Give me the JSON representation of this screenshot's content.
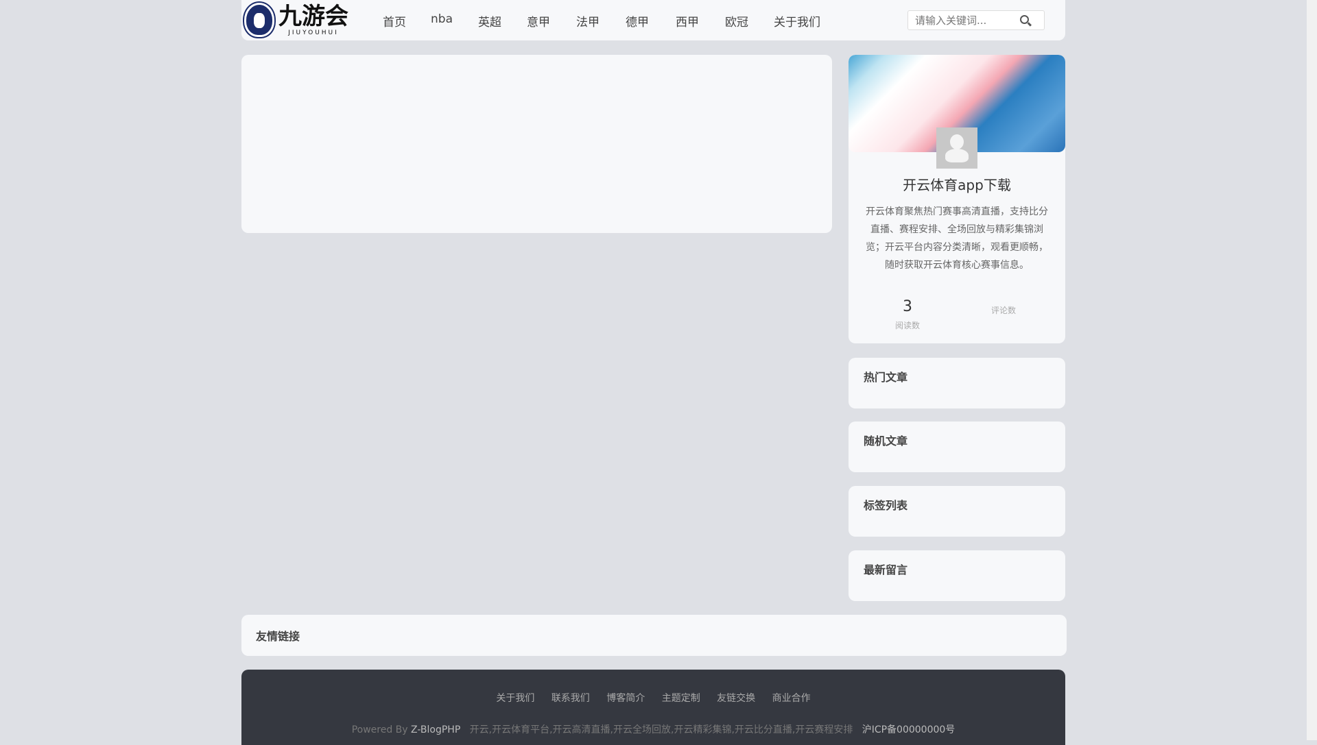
{
  "header": {
    "logo_cn": "九游会",
    "logo_en": "JIUYOUHUI",
    "nav": [
      "首页",
      "nba",
      "英超",
      "意甲",
      "法甲",
      "德甲",
      "西甲",
      "欧冠",
      "关于我们"
    ],
    "search_placeholder": "请输入关键词..."
  },
  "profile": {
    "name": "开云体育app下载",
    "description": "开云体育聚焦热门赛事高清直播，支持比分直播、赛程安排、全场回放与精彩集锦浏览；开云平台内容分类清晰，观看更顺畅，随时获取开云体育核心赛事信息。",
    "views_count": "3",
    "views_label": "阅读数",
    "comments_label": "评论数"
  },
  "widgets": [
    "热门文章",
    "随机文章",
    "标签列表",
    "最新留言"
  ],
  "links_title": "友情链接",
  "footer": {
    "links": [
      "关于我们",
      "联系我们",
      "博客简介",
      "主题定制",
      "友链交换",
      "商业合作"
    ],
    "powered": "Powered By",
    "powered_name": "Z-BlogPHP",
    "keywords": "开云,开云体育平台,开云高清直播,开云全场回放,开云精彩集锦,开云比分直播,开云赛程安排",
    "icp": "沪ICP备00000000号"
  }
}
